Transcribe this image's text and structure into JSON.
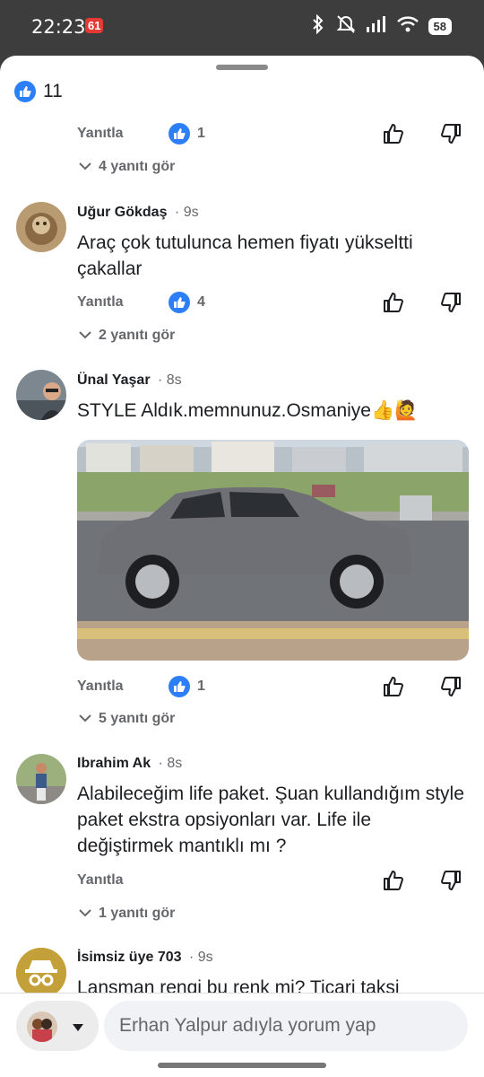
{
  "status_bar": {
    "time": "22:23",
    "notif_badge": "61",
    "battery": "58"
  },
  "top_reaction": {
    "count": "11"
  },
  "actions_common": {
    "reply_label": "Yanıtla"
  },
  "thread0": {
    "like_count": "1",
    "replies": "4 yanıtı gör"
  },
  "comments": [
    {
      "name": "Uğur Gökdaş",
      "time": "9s",
      "text": "Araç çok tutulunca hemen fiyatı yükseltti çakallar",
      "like_count": "4",
      "replies": "2 yanıtı gör"
    },
    {
      "name": "Ünal Yaşar",
      "time": "8s",
      "text": "STYLE Aldık.memnunuz.Osmaniye👍🙋",
      "like_count": "1",
      "replies": "5 yanıtı gör"
    },
    {
      "name": "Ibrahim Ak",
      "time": "8s",
      "text": "Alabileceğim life paket. Şuan kullandığım style paket ekstra opsiyonları var. Life ile değiştirmek mantıklı mı ?",
      "replies": "1 yanıtı gör"
    },
    {
      "name": "İsimsiz üye 703",
      "time": "9s",
      "text": "Lansman rengi bu renk mi? Ticari taksi"
    }
  ],
  "composer": {
    "placeholder": "Erhan Yalpur adıyla yorum yap"
  },
  "colors": {
    "accent": "#2d7ff9",
    "secondary_text": "#65676b"
  }
}
